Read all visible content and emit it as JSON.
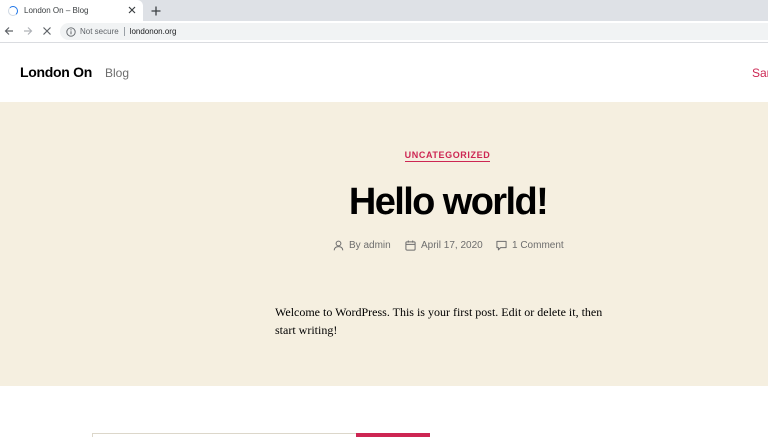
{
  "browser": {
    "tab_title": "London On – Blog",
    "security_label": "Not secure",
    "url": "londonon.org"
  },
  "site": {
    "title": "London On",
    "nav_item": "Blog",
    "header_right_partial": "Sar"
  },
  "post": {
    "category": "UNCATEGORIZED",
    "title": "Hello world!",
    "author": "By admin",
    "date": "April 17, 2020",
    "comments": "1 Comment",
    "content": "Welcome to WordPress. This is your first post. Edit or delete it, then start writing!"
  },
  "colors": {
    "accent": "#cd2653",
    "hero_background": "#f5efe0",
    "meta_text": "#6d6d6d"
  },
  "icons": {
    "tab": "loading-spinner-icon",
    "tab_close": "close-icon",
    "new_tab": "plus-icon",
    "back": "back-arrow-icon",
    "forward": "forward-arrow-icon",
    "stop": "stop-icon",
    "security": "info-icon",
    "author": "user-icon",
    "date": "calendar-icon",
    "comments": "comment-icon"
  }
}
